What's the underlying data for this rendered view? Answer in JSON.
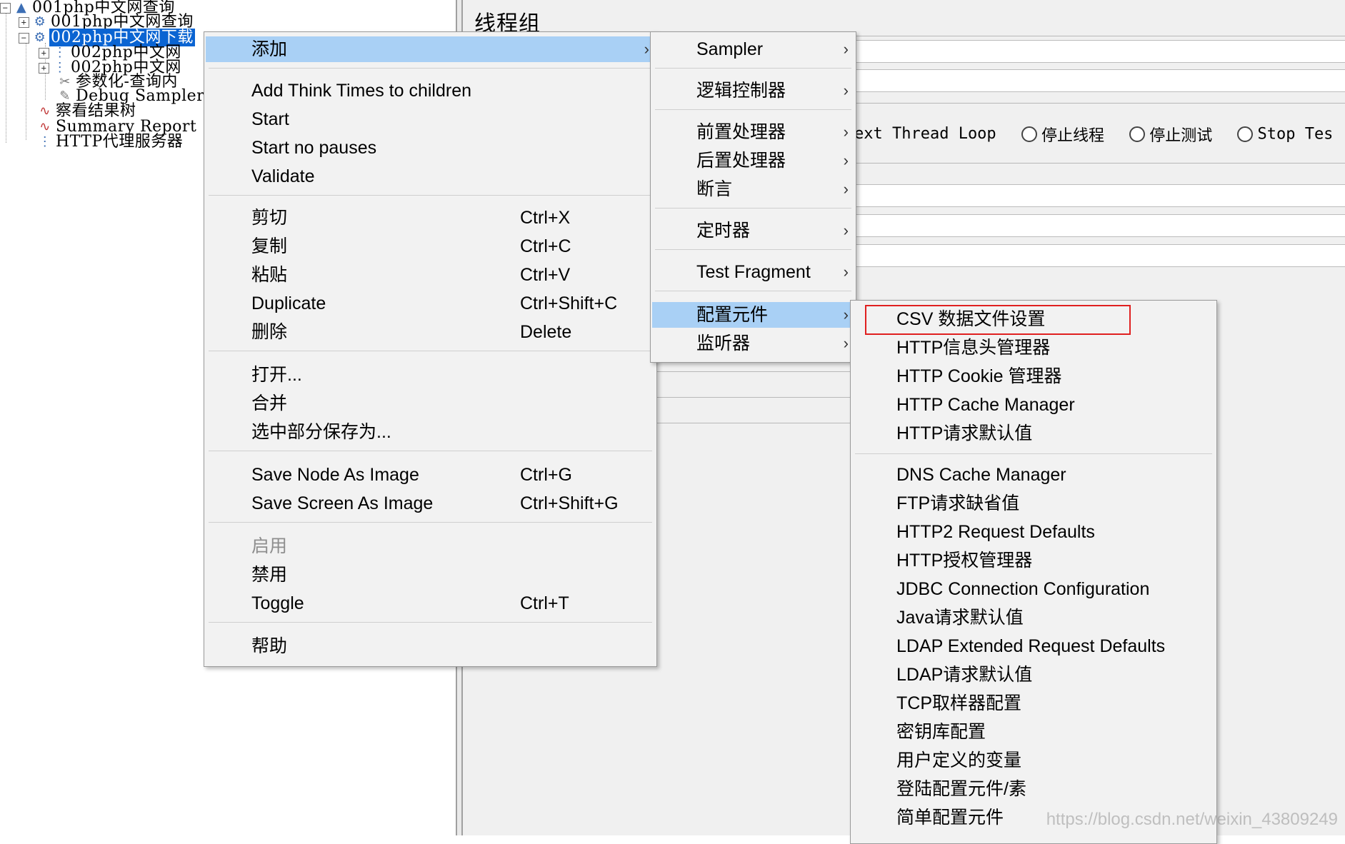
{
  "tree": {
    "items": [
      {
        "label": "001php中文网查询",
        "icon": "thread-group-icon"
      },
      {
        "label": "001php中文网查询",
        "icon": "thread-group-icon"
      },
      {
        "label": "002php中文网下载",
        "icon": "thread-group-icon"
      },
      {
        "label": "002php中文网",
        "icon": "sampler-icon"
      },
      {
        "label": "002php中文网",
        "icon": "sampler-icon"
      },
      {
        "label": "参数化-查询内",
        "icon": "config-icon"
      },
      {
        "label": "Debug Sampler",
        "icon": "pen-icon"
      },
      {
        "label": "察看结果树",
        "icon": "listener-icon"
      },
      {
        "label": "Summary Report",
        "icon": "listener-icon"
      },
      {
        "label": "HTTP代理服务器",
        "icon": "proxy-icon"
      }
    ]
  },
  "panel": {
    "title": "线程组",
    "action_row": {
      "partial_label": "ext Thread Loop",
      "options": [
        "停止线程",
        "停止测试",
        "Stop Tes"
      ]
    }
  },
  "context_menu": {
    "items": [
      {
        "label": "添加",
        "shortcut": "",
        "submenu": true,
        "highlighted": true
      },
      {
        "label": "Add Think Times to children",
        "shortcut": ""
      },
      {
        "label": "Start",
        "shortcut": ""
      },
      {
        "label": "Start no pauses",
        "shortcut": ""
      },
      {
        "label": "Validate",
        "shortcut": ""
      },
      {
        "label": "剪切",
        "shortcut": "Ctrl+X"
      },
      {
        "label": "复制",
        "shortcut": "Ctrl+C"
      },
      {
        "label": "粘贴",
        "shortcut": "Ctrl+V"
      },
      {
        "label": "Duplicate",
        "shortcut": "Ctrl+Shift+C"
      },
      {
        "label": "删除",
        "shortcut": "Delete"
      },
      {
        "label": "打开...",
        "shortcut": ""
      },
      {
        "label": "合并",
        "shortcut": ""
      },
      {
        "label": "选中部分保存为...",
        "shortcut": ""
      },
      {
        "label": "Save Node As Image",
        "shortcut": "Ctrl+G"
      },
      {
        "label": "Save Screen As Image",
        "shortcut": "Ctrl+Shift+G"
      },
      {
        "label": "启用",
        "shortcut": "",
        "disabled": true
      },
      {
        "label": "禁用",
        "shortcut": ""
      },
      {
        "label": "Toggle",
        "shortcut": "Ctrl+T"
      },
      {
        "label": "帮助",
        "shortcut": ""
      }
    ]
  },
  "add_submenu": {
    "items": [
      {
        "label": "Sampler"
      },
      {
        "label": "逻辑控制器"
      },
      {
        "label": "前置处理器"
      },
      {
        "label": "后置处理器"
      },
      {
        "label": "断言"
      },
      {
        "label": "定时器"
      },
      {
        "label": "Test Fragment"
      },
      {
        "label": "配置元件",
        "highlighted": true
      },
      {
        "label": "监听器"
      }
    ]
  },
  "config_submenu": {
    "items": [
      {
        "label": "CSV 数据文件设置",
        "boxed": true
      },
      {
        "label": "HTTP信息头管理器"
      },
      {
        "label": "HTTP Cookie 管理器"
      },
      {
        "label": "HTTP Cache Manager"
      },
      {
        "label": "HTTP请求默认值"
      },
      {
        "label": "DNS Cache Manager"
      },
      {
        "label": "FTP请求缺省值"
      },
      {
        "label": "HTTP2 Request Defaults"
      },
      {
        "label": "HTTP授权管理器"
      },
      {
        "label": "JDBC Connection Configuration"
      },
      {
        "label": "Java请求默认值"
      },
      {
        "label": "LDAP Extended Request Defaults"
      },
      {
        "label": "LDAP请求默认值"
      },
      {
        "label": "TCP取样器配置"
      },
      {
        "label": "密钥库配置"
      },
      {
        "label": "用户定义的变量"
      },
      {
        "label": "登陆配置元件/素"
      },
      {
        "label": "简单配置元件"
      }
    ]
  },
  "colors": {
    "menu_highlight": "#a9d0f5",
    "tree_selection": "#0a64d2",
    "csv_box": "#e02020"
  },
  "watermark": "https://blog.csdn.net/weixin_43809249"
}
